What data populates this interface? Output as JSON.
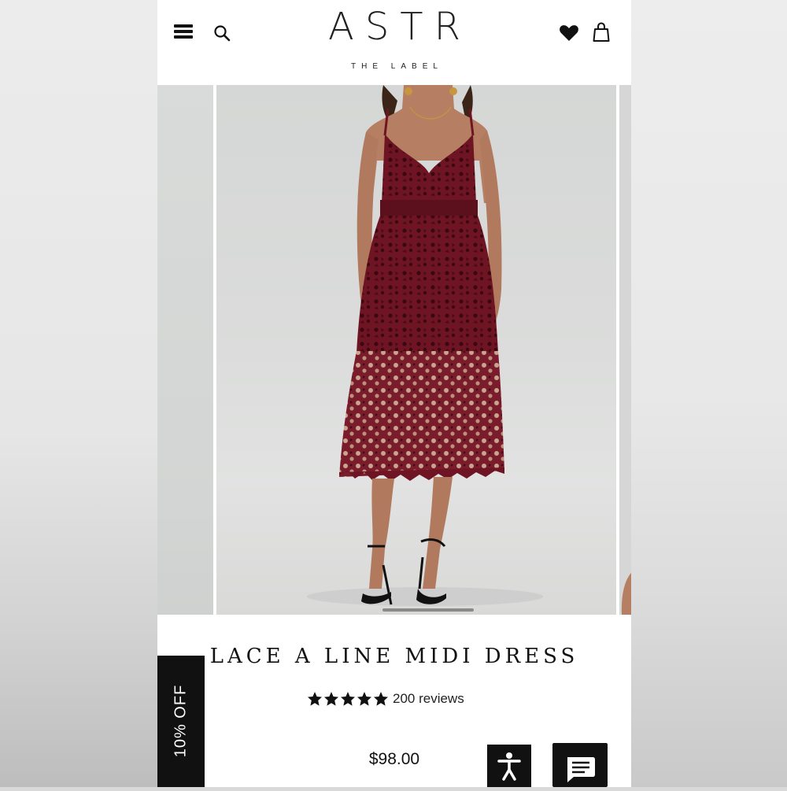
{
  "brand": {
    "logo": "ASTR",
    "tagline": "THE LABEL"
  },
  "header": {
    "icons": [
      "menu-icon",
      "search-icon",
      "heart-icon",
      "bag-icon"
    ]
  },
  "product": {
    "name": "LACE A LINE MIDI DRESS",
    "rating": 5,
    "rating_max": 5,
    "reviews": "200 reviews",
    "price": "$98.00",
    "image_alt": "model wearing burgundy lace midi dress"
  },
  "promo": {
    "discount_label": "10% OFF"
  },
  "colors": {
    "dress": "#6e1423",
    "ink": "#111111"
  }
}
